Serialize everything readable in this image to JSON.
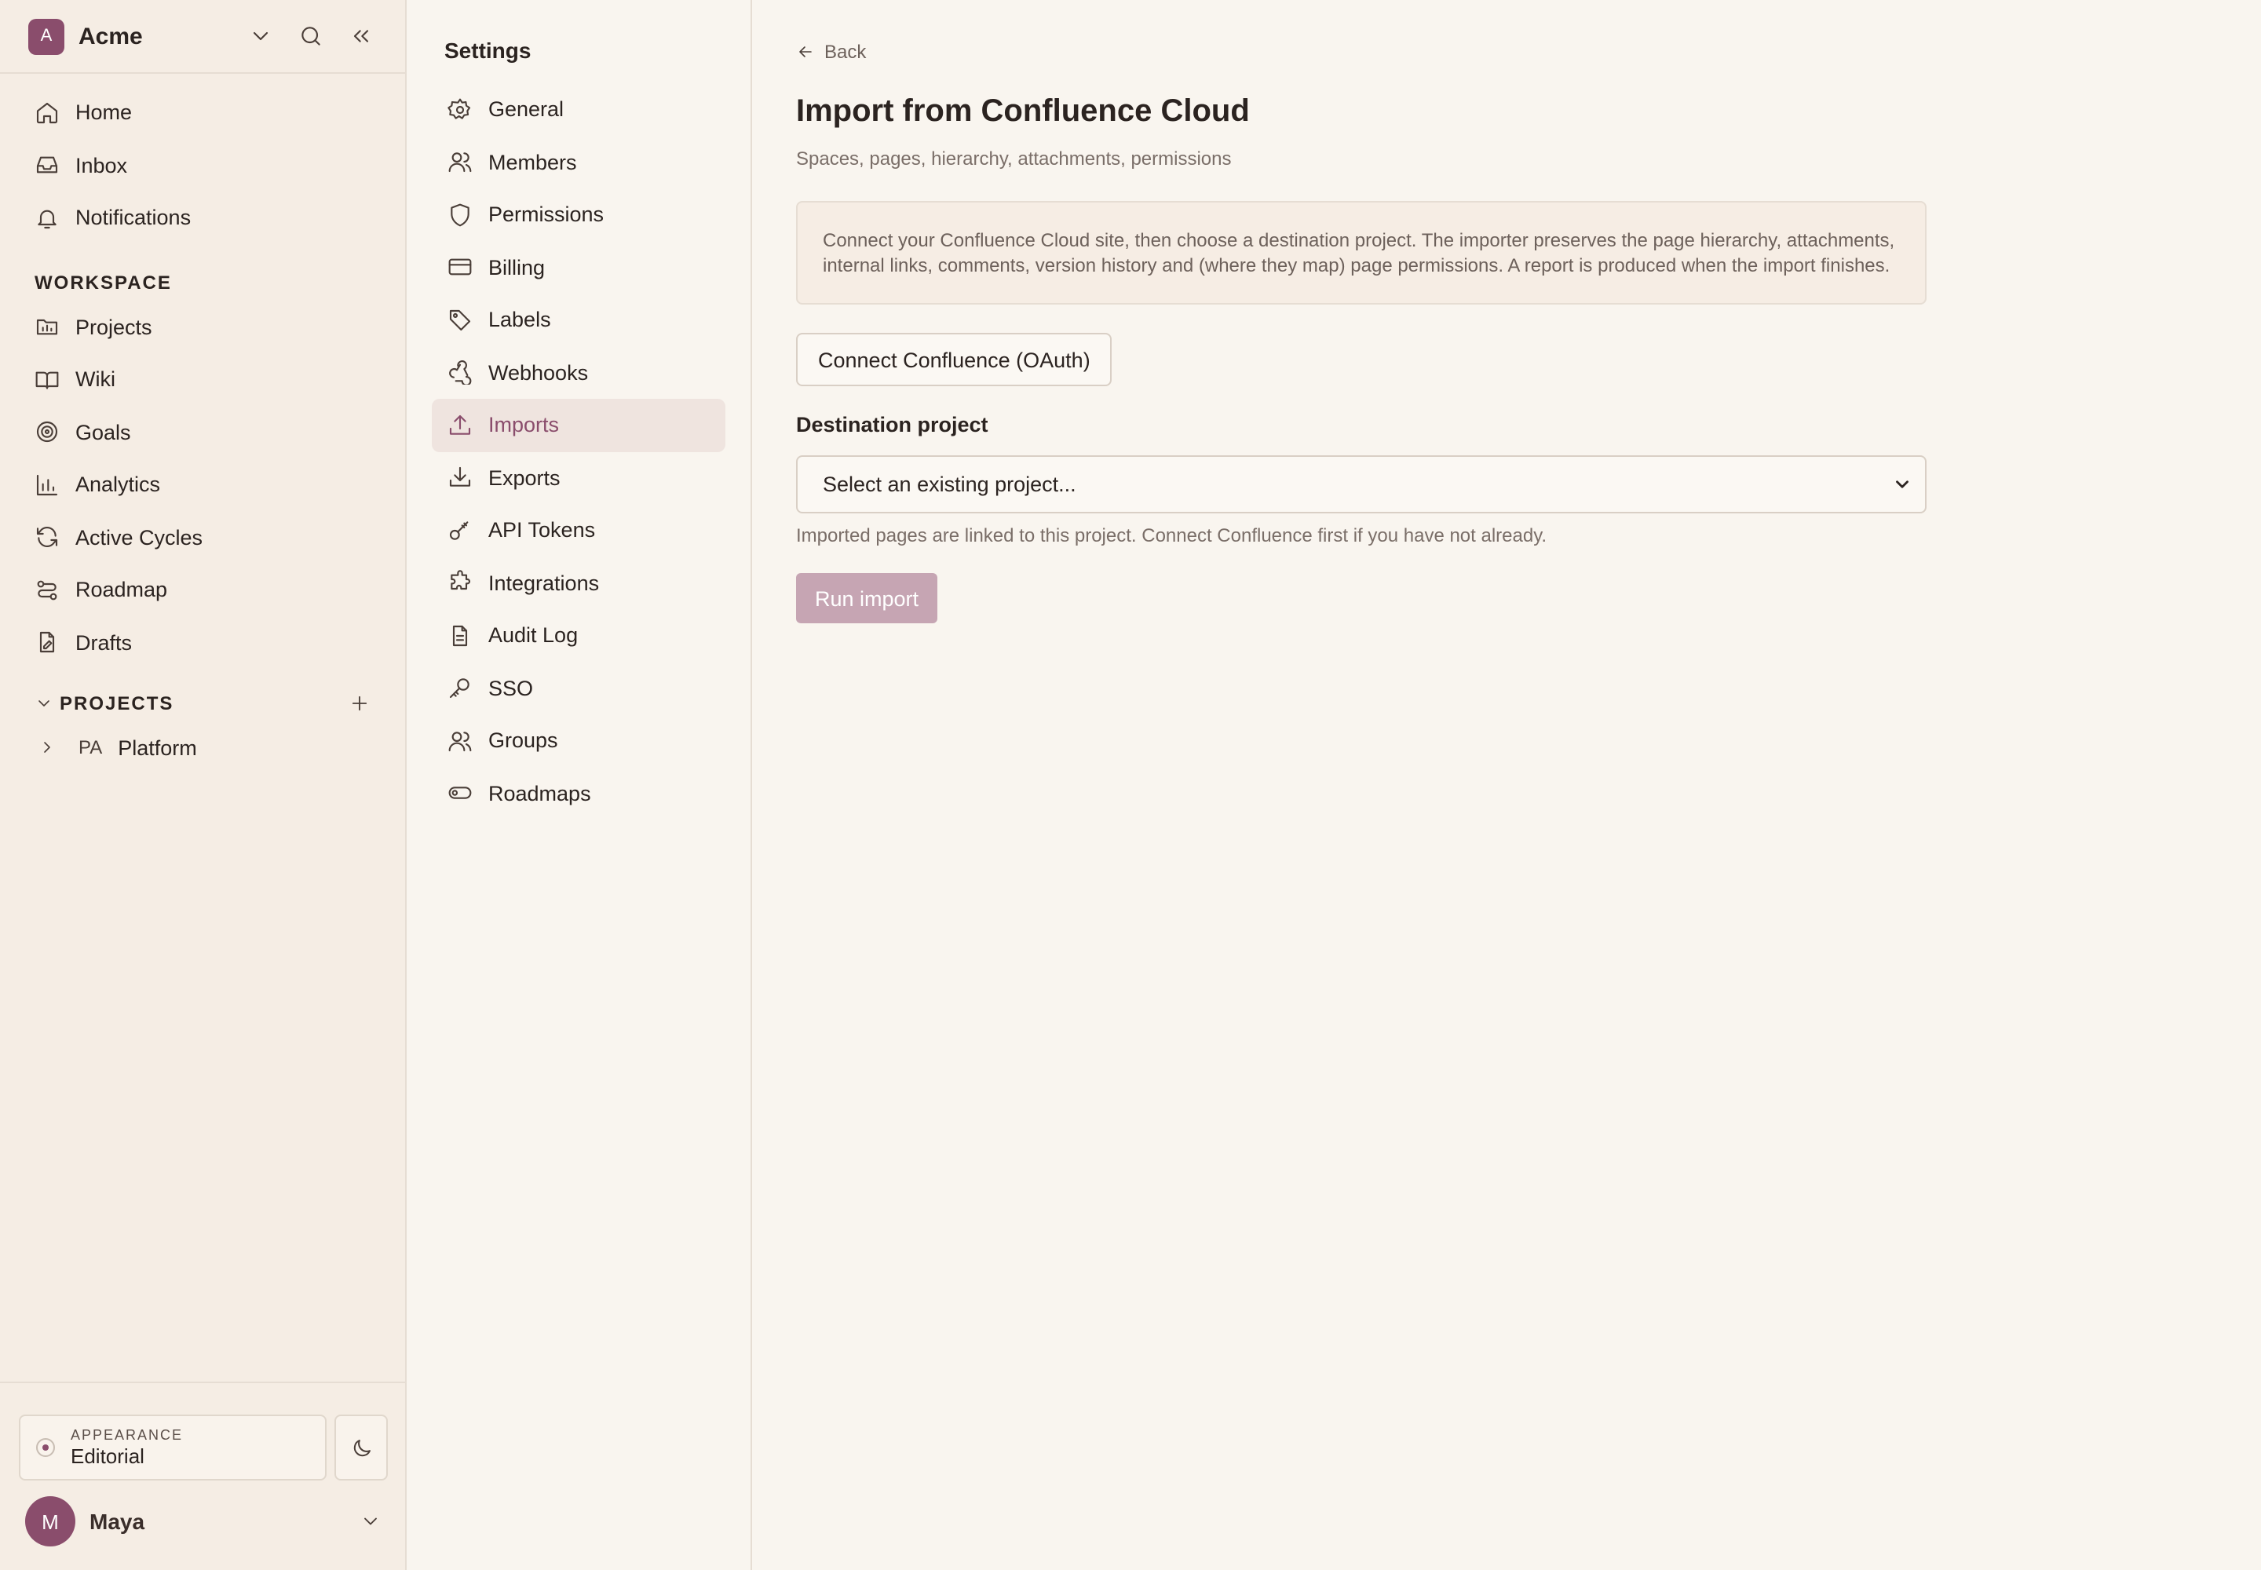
{
  "workspace": {
    "avatar_letter": "A",
    "name": "Acme"
  },
  "sidebar": {
    "primary": [
      {
        "label": "Home",
        "icon": "home-icon"
      },
      {
        "label": "Inbox",
        "icon": "inbox-icon"
      },
      {
        "label": "Notifications",
        "icon": "bell-icon"
      }
    ],
    "workspace_title": "WORKSPACE",
    "workspace_items": [
      {
        "label": "Projects",
        "icon": "projects-icon"
      },
      {
        "label": "Wiki",
        "icon": "book-icon"
      },
      {
        "label": "Goals",
        "icon": "target-icon"
      },
      {
        "label": "Analytics",
        "icon": "bar-chart-icon"
      },
      {
        "label": "Active Cycles",
        "icon": "refresh-icon"
      },
      {
        "label": "Roadmap",
        "icon": "route-icon"
      },
      {
        "label": "Drafts",
        "icon": "draft-icon"
      }
    ],
    "projects_title": "PROJECTS",
    "projects": [
      {
        "code": "PA",
        "name": "Platform"
      }
    ],
    "appearance": {
      "label": "APPEARANCE",
      "value": "Editorial"
    },
    "user": {
      "initial": "M",
      "name": "Maya"
    }
  },
  "settings": {
    "title": "Settings",
    "items": [
      {
        "label": "General",
        "icon": "gear-icon"
      },
      {
        "label": "Members",
        "icon": "user-icon"
      },
      {
        "label": "Permissions",
        "icon": "shield-icon"
      },
      {
        "label": "Billing",
        "icon": "credit-card-icon"
      },
      {
        "label": "Labels",
        "icon": "tag-icon"
      },
      {
        "label": "Webhooks",
        "icon": "webhook-icon"
      },
      {
        "label": "Imports",
        "icon": "upload-icon",
        "active": true
      },
      {
        "label": "Exports",
        "icon": "download-icon"
      },
      {
        "label": "API Tokens",
        "icon": "key-icon"
      },
      {
        "label": "Integrations",
        "icon": "puzzle-icon"
      },
      {
        "label": "Audit Log",
        "icon": "file-text-icon"
      },
      {
        "label": "SSO",
        "icon": "key-round-icon"
      },
      {
        "label": "Groups",
        "icon": "users-icon"
      },
      {
        "label": "Roadmaps",
        "icon": "toggle-icon"
      }
    ]
  },
  "main": {
    "back_label": "Back",
    "title": "Import from Confluence Cloud",
    "subtitle": "Spaces, pages, hierarchy, attachments, permissions",
    "info": "Connect your Confluence Cloud site, then choose a destination project. The importer preserves the page hierarchy, attachments, internal links, comments, version history and (where they map) page permissions. A report is produced when the import finishes.",
    "connect_button": "Connect Confluence (OAuth)",
    "destination_label": "Destination project",
    "select_value": "Select an existing project...",
    "hint": "Imported pages are linked to this project. Connect Confluence first if you have not already.",
    "run_button": "Run import"
  },
  "colors": {
    "accent": "#8a4d6c",
    "background": "#f9f5ef",
    "sidebar": "#f5ede4",
    "disabled_button": "#c6a5b3"
  }
}
